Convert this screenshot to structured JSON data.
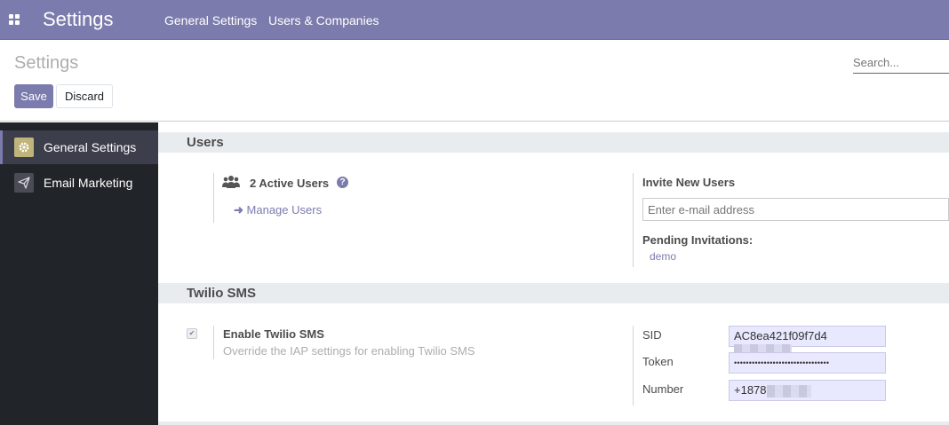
{
  "topbar": {
    "app_title": "Settings",
    "menu": [
      "General Settings",
      "Users & Companies"
    ]
  },
  "control_panel": {
    "title": "Settings",
    "save_label": "Save",
    "discard_label": "Discard",
    "search_placeholder": "Search..."
  },
  "sidebar": {
    "items": [
      {
        "label": "General Settings",
        "icon": "gear-icon",
        "active": true
      },
      {
        "label": "Email Marketing",
        "icon": "paper-plane-icon",
        "active": false
      }
    ]
  },
  "users_section": {
    "title": "Users",
    "active_users": "2 Active Users",
    "manage_users": "Manage Users",
    "invite_title": "Invite New Users",
    "invite_placeholder": "Enter e-mail address",
    "pending_title": "Pending Invitations:",
    "pending_list": [
      "demo"
    ]
  },
  "twilio_section": {
    "title": "Twilio SMS",
    "enable_label": "Enable Twilio SMS",
    "enable_help": "Override the IAP settings for enabling Twilio SMS",
    "enabled": true,
    "sid_label": "SID",
    "sid_value": "AC8ea421f09f7d4",
    "token_label": "Token",
    "token_value": "••••••••••••••••••••••••••••••••",
    "number_label": "Number",
    "number_value": "+1878"
  },
  "colors": {
    "brand": "#7c7bad",
    "sidebar_bg": "#212428",
    "sidebar_active": "#3c3e4b",
    "gear_icon_bg": "#c1b47a",
    "filled_field": "#e8e8ff"
  }
}
